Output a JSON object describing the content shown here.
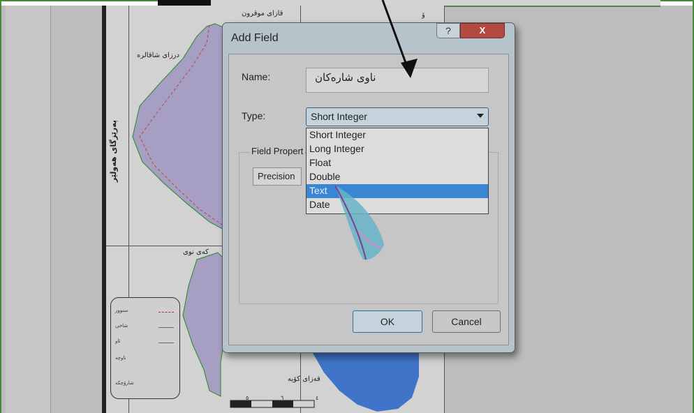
{
  "dialog": {
    "title": "Add Field",
    "help_glyph": "?",
    "close_glyph": "X",
    "name_label": "Name:",
    "name_value": "ناوی شارەکان",
    "type_label": "Type:",
    "type_selected": "Short Integer",
    "type_options": [
      "Short Integer",
      "Long Integer",
      "Float",
      "Double",
      "Text",
      "Date"
    ],
    "highlighted_option": "Text",
    "field_properties_label": "Field Propert",
    "precision_label": "Precision",
    "ok_label": "OK",
    "cancel_label": "Cancel"
  },
  "map": {
    "labels": {
      "top_center": "قازاى موقرون",
      "top_right": "ۆ",
      "left_upper": "درزاى شاقالره",
      "vertical_label": "پەرێزگای هەولێر",
      "middle_left": "کەی نوى",
      "bottom_center": "قەزای کۆیە"
    },
    "legend_items": [
      "سنوور",
      "شاخى",
      "ئاو",
      "ناوچە",
      "شارۆچکە"
    ],
    "ruler_ticks": [
      "٥",
      "٦",
      "٤"
    ]
  },
  "colors": {
    "map_polygon": "#a79ec4",
    "water": "#3f74c8",
    "highlight": "#3a86d3",
    "frame": "#4a8a3c"
  }
}
